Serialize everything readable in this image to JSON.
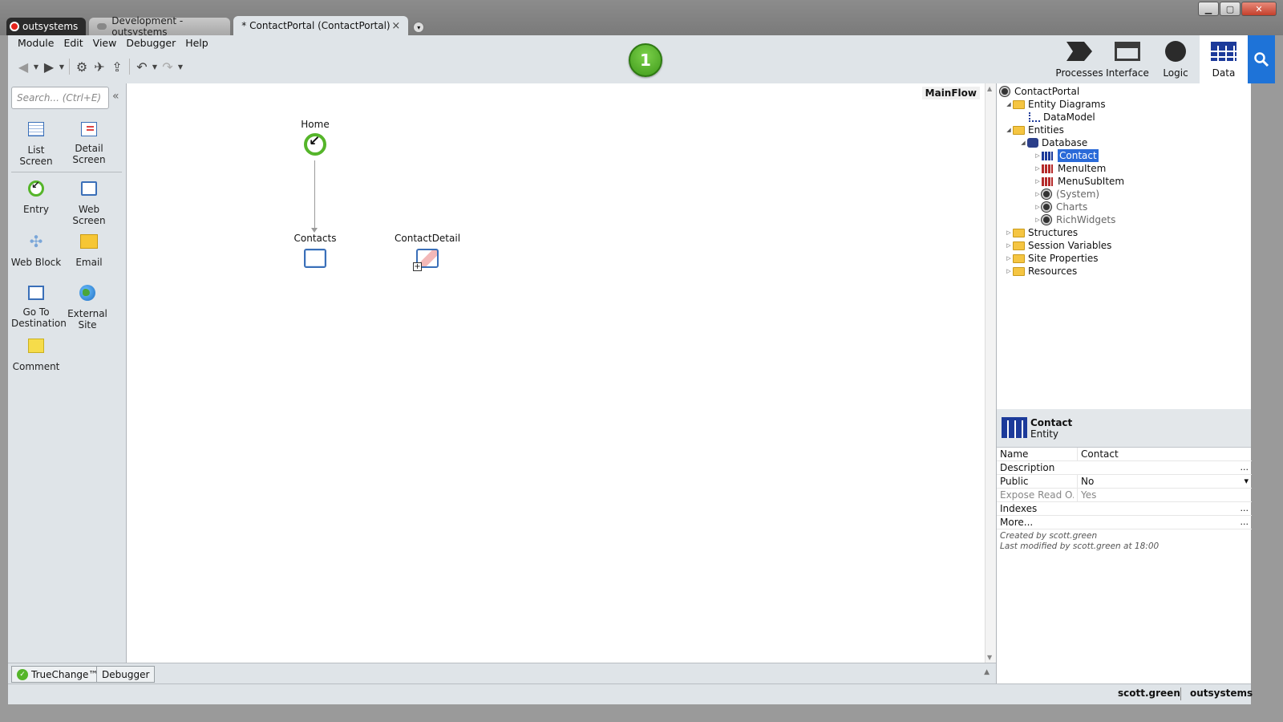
{
  "tabs": {
    "brand": "outsystems",
    "development": "Development - outsystems",
    "active": "* ContactPortal (ContactPortal)",
    "close": "×",
    "more": "▾"
  },
  "menu": [
    "Module",
    "Edit",
    "View",
    "Debugger",
    "Help"
  ],
  "badge": "1",
  "layers": [
    "Processes",
    "Interface",
    "Logic",
    "Data"
  ],
  "toolbox": {
    "search_placeholder": "Search... (Ctrl+E)",
    "items": {
      "list_screen": "List Screen",
      "detail_screen": "Detail Screen",
      "entry": "Entry",
      "web_screen": "Web Screen",
      "web_block": "Web Block",
      "email": "Email",
      "go_to_destination": "Go To Destination",
      "external_site": "External Site",
      "comment": "Comment"
    }
  },
  "canvas": {
    "flow_name": "MainFlow",
    "nodes": {
      "home": "Home",
      "contacts": "Contacts",
      "contact_detail": "ContactDetail"
    }
  },
  "bottom_tabs": [
    "TrueChange™",
    "Debugger"
  ],
  "tree": {
    "root": "ContactPortal",
    "entity_diagrams": "Entity Diagrams",
    "data_model": "DataModel",
    "entities": "Entities",
    "database": "Database",
    "contact": "Contact",
    "menu_item": "MenuItem",
    "menu_sub_item": "MenuSubItem",
    "system": "(System)",
    "charts": "Charts",
    "rich_widgets": "RichWidgets",
    "structures": "Structures",
    "session_variables": "Session Variables",
    "site_properties": "Site Properties",
    "resources": "Resources"
  },
  "properties": {
    "title": "Contact",
    "type": "Entity",
    "rows": {
      "name": {
        "key": "Name",
        "value": "Contact"
      },
      "description": {
        "key": "Description",
        "value": "",
        "btn": "..."
      },
      "public": {
        "key": "Public",
        "value": "No",
        "btn": "▾"
      },
      "expose": {
        "key": "Expose Read O...",
        "value": "Yes"
      },
      "indexes": {
        "key": "Indexes",
        "value": "",
        "btn": "..."
      },
      "more": {
        "key": "More...",
        "value": "",
        "btn": "..."
      }
    },
    "created_by": "Created by scott.green",
    "modified_by": "Last modified by scott.green at 18:00"
  },
  "status": {
    "user": "scott.green",
    "server": "outsystems"
  },
  "colors": {
    "accent": "#1e73d8",
    "entry_green": "#55b52a",
    "badge_green": "#4ea824",
    "brand_red": "#e8231c"
  }
}
